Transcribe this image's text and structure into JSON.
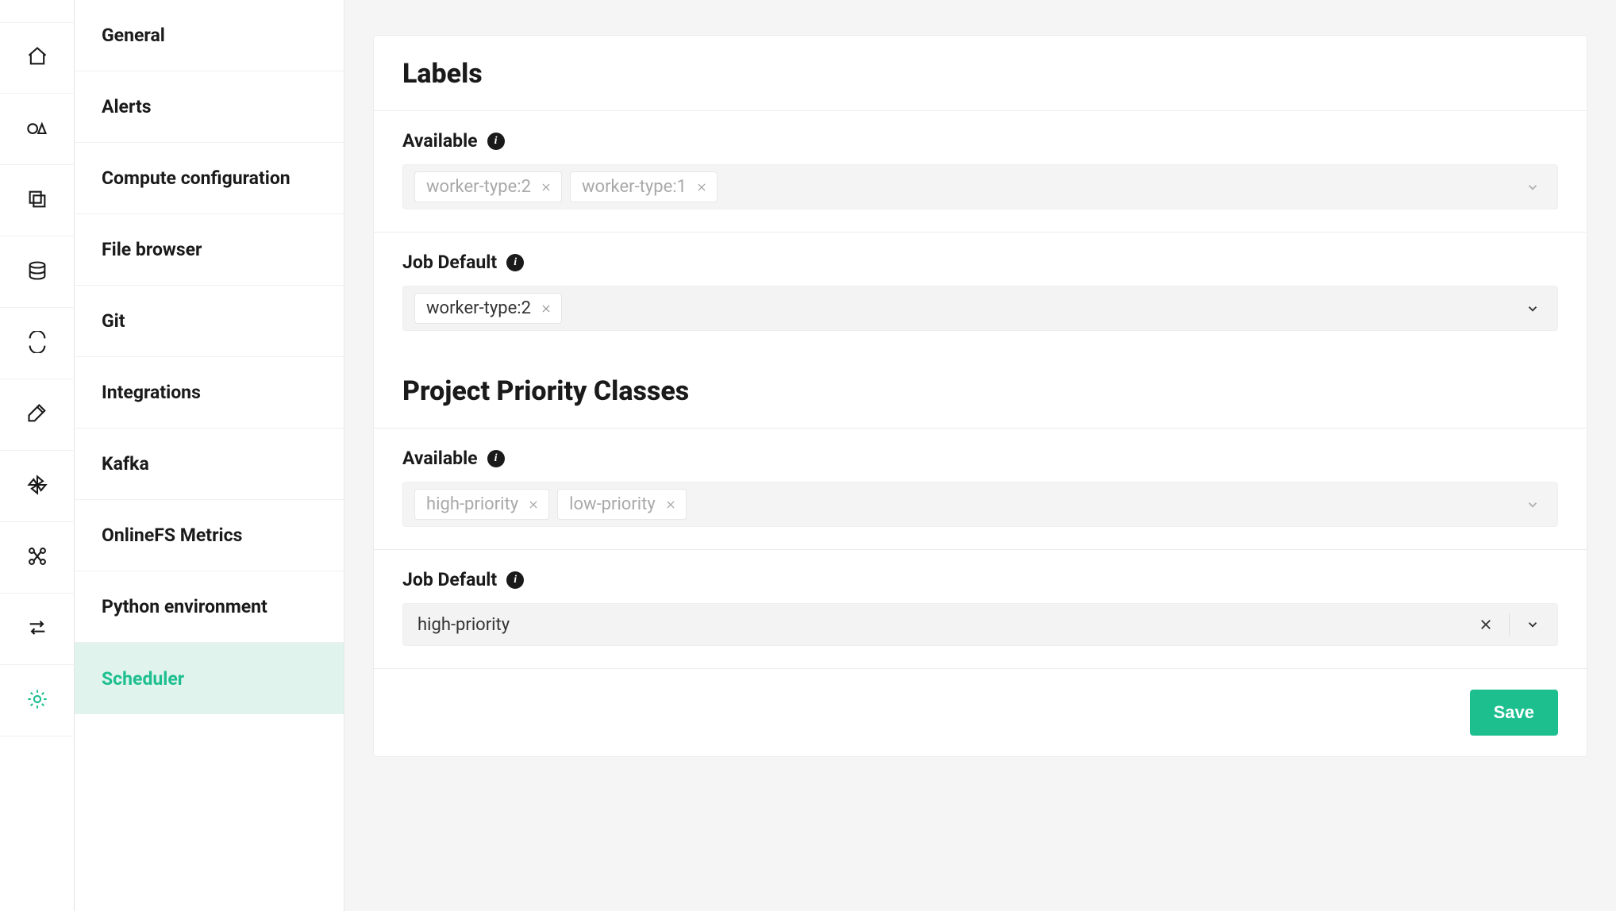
{
  "rail_icons": [
    "home-icon",
    "shapes-icon",
    "copy-icon",
    "database-icon",
    "sync-icon",
    "axe-icon",
    "pinwheel-icon",
    "network-icon",
    "swap-icon",
    "gear-icon"
  ],
  "sidebar": {
    "items": [
      {
        "label": "General"
      },
      {
        "label": "Alerts"
      },
      {
        "label": "Compute configuration"
      },
      {
        "label": "File browser"
      },
      {
        "label": "Git"
      },
      {
        "label": "Integrations"
      },
      {
        "label": "Kafka"
      },
      {
        "label": "OnlineFS Metrics"
      },
      {
        "label": "Python environment"
      },
      {
        "label": "Scheduler"
      }
    ],
    "active_index": 9
  },
  "labels_section": {
    "title": "Labels",
    "available_label": "Available",
    "available_chips": [
      "worker-type:2",
      "worker-type:1"
    ],
    "job_default_label": "Job Default",
    "job_default_chips": [
      "worker-type:2"
    ]
  },
  "priority_section": {
    "title": "Project Priority Classes",
    "available_label": "Available",
    "available_chips": [
      "high-priority",
      "low-priority"
    ],
    "job_default_label": "Job Default",
    "job_default_value": "high-priority"
  },
  "footer": {
    "save_label": "Save"
  }
}
